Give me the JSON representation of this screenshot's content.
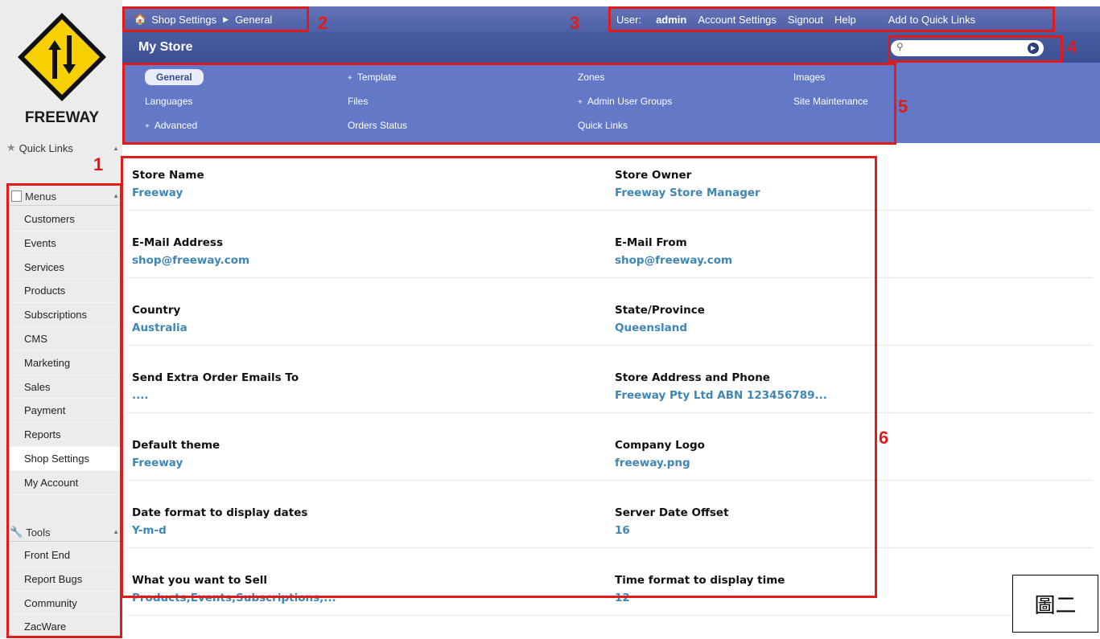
{
  "logo": {
    "text": "FREEWAY"
  },
  "sidebar": {
    "quick_links_label": "Quick Links",
    "menus_label": "Menus",
    "menus": [
      {
        "label": "Customers"
      },
      {
        "label": "Events"
      },
      {
        "label": "Services"
      },
      {
        "label": "Products"
      },
      {
        "label": "Subscriptions"
      },
      {
        "label": "CMS"
      },
      {
        "label": "Marketing"
      },
      {
        "label": "Sales"
      },
      {
        "label": "Payment"
      },
      {
        "label": "Reports"
      },
      {
        "label": "Shop Settings"
      },
      {
        "label": "My Account"
      }
    ],
    "active_menu": "Shop Settings",
    "tools_label": "Tools",
    "tools": [
      {
        "label": "Front End"
      },
      {
        "label": "Report Bugs"
      },
      {
        "label": "Community"
      },
      {
        "label": "ZacWare"
      }
    ]
  },
  "topbar": {
    "breadcrumb": [
      "Shop Settings",
      "General"
    ],
    "user_prefix": "User:",
    "username": "admin",
    "links": [
      "Account Settings",
      "Signout",
      "Help"
    ],
    "quick_link": "Add to Quick Links"
  },
  "store": {
    "title": "My Store"
  },
  "search": {
    "placeholder": ""
  },
  "nav": {
    "items": [
      {
        "label": "General",
        "selected": true,
        "expandable": false
      },
      {
        "label": "Template",
        "selected": false,
        "expandable": true
      },
      {
        "label": "Zones",
        "selected": false,
        "expandable": false
      },
      {
        "label": "Images",
        "selected": false,
        "expandable": false
      },
      {
        "label": "Languages",
        "selected": false,
        "expandable": false
      },
      {
        "label": "Files",
        "selected": false,
        "expandable": false
      },
      {
        "label": "Admin User Groups",
        "selected": false,
        "expandable": true
      },
      {
        "label": "Site Maintenance",
        "selected": false,
        "expandable": false
      },
      {
        "label": "Advanced",
        "selected": false,
        "expandable": true
      },
      {
        "label": "Orders Status",
        "selected": false,
        "expandable": false
      },
      {
        "label": "Quick Links",
        "selected": false,
        "expandable": false
      }
    ]
  },
  "settings": [
    {
      "label": "Store Name",
      "value": "Freeway"
    },
    {
      "label": "Store Owner",
      "value": "Freeway Store Manager"
    },
    {
      "label": "E-Mail Address",
      "value": "shop@freeway.com"
    },
    {
      "label": "E-Mail From",
      "value": "shop@freeway.com"
    },
    {
      "label": "Country",
      "value": "Australia"
    },
    {
      "label": "State/Province",
      "value": "Queensland"
    },
    {
      "label": "Send Extra Order Emails To",
      "value": "...."
    },
    {
      "label": "Store Address and Phone",
      "value": "Freeway Pty Ltd ABN 123456789..."
    },
    {
      "label": "Default theme",
      "value": "Freeway"
    },
    {
      "label": "Company Logo",
      "value": "freeway.png"
    },
    {
      "label": "Date format to display dates",
      "value": "Y-m-d"
    },
    {
      "label": "Server Date Offset",
      "value": "16"
    },
    {
      "label": "What you want to Sell",
      "value": "Products,Events,Subscriptions,..."
    },
    {
      "label": "Time format to display time",
      "value": "12"
    }
  ],
  "annotations": {
    "numbers": [
      "1",
      "2",
      "3",
      "4",
      "5",
      "6"
    ],
    "caption": "圖二",
    "color": "#e01b1b"
  },
  "colors": {
    "topbar": "#5366ad",
    "storebar": "#4457a0",
    "navpanel": "#6378c7",
    "value_text": "#3e86b5"
  }
}
